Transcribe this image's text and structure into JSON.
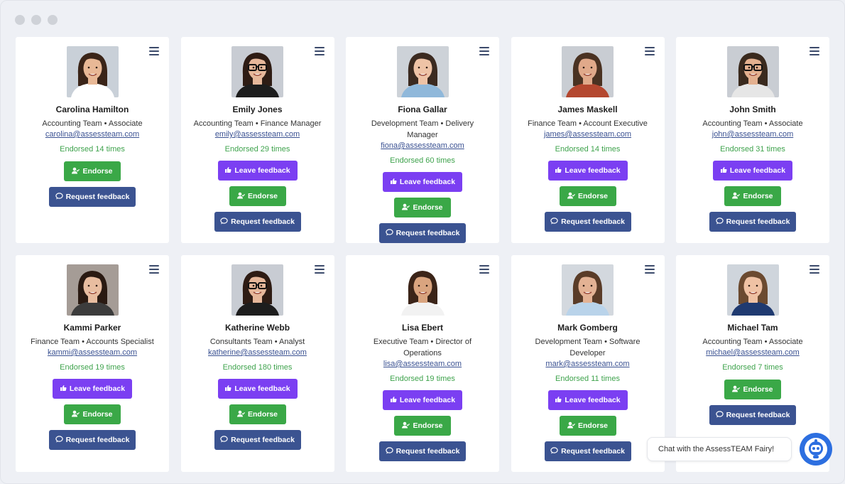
{
  "window": {
    "title": ""
  },
  "people": [
    {
      "name": "Carolina Hamilton",
      "role": "Accounting Team • Associate",
      "email": "carolina@assessteam.com",
      "endorsed": "Endorsed 14 times",
      "buttons": [
        "endorse",
        "request"
      ],
      "skin": "#e8b896",
      "hair": "#3a2418",
      "shirt": "#ffffff",
      "bg": "#c9d0d8",
      "glasses": false
    },
    {
      "name": "Emily Jones",
      "role": "Accounting Team • Finance Manager",
      "email": "emily@assessteam.com",
      "endorsed": "Endorsed 29 times",
      "buttons": [
        "leave",
        "endorse",
        "request"
      ],
      "skin": "#e6b79a",
      "hair": "#2e1c14",
      "shirt": "#1d1d1d",
      "bg": "#c8ccd3",
      "glasses": true
    },
    {
      "name": "Fiona Gallar",
      "role": "Development Team • Delivery Manager",
      "email": "fiona@assessteam.com",
      "endorsed": "Endorsed 60 times",
      "buttons": [
        "leave",
        "endorse",
        "request"
      ],
      "skin": "#eec3a6",
      "hair": "#3b2a20",
      "shirt": "#8fb8da",
      "bg": "#cdd2d8",
      "glasses": false
    },
    {
      "name": "James Maskell",
      "role": "Finance Team • Account Executive",
      "email": "james@assessteam.com",
      "endorsed": "Endorsed 14 times",
      "buttons": [
        "leave",
        "endorse",
        "request"
      ],
      "skin": "#e0a98a",
      "hair": "#4a3222",
      "shirt": "#b4472f",
      "bg": "#c9cdd3",
      "glasses": false
    },
    {
      "name": "John Smith",
      "role": "Accounting Team • Associate",
      "email": "john@assessteam.com",
      "endorsed": "Endorsed 31 times",
      "buttons": [
        "leave",
        "endorse",
        "request"
      ],
      "skin": "#e3b08f",
      "hair": "#3a2a1e",
      "shirt": "#e6e6e6",
      "bg": "#c9cdd3",
      "glasses": true
    },
    {
      "name": "Kammi Parker",
      "role": "Finance Team • Accounts Specialist",
      "email": "kammi@assessteam.com",
      "endorsed": "Endorsed 19 times",
      "buttons": [
        "leave",
        "endorse",
        "request"
      ],
      "skin": "#e8bda0",
      "hair": "#2a1a12",
      "shirt": "#3c3c3c",
      "bg": "#a59c96",
      "glasses": false
    },
    {
      "name": "Katherine Webb",
      "role": "Consultants Team • Analyst",
      "email": "katherine@assessteam.com",
      "endorsed": "Endorsed 180 times",
      "buttons": [
        "leave",
        "endorse",
        "request"
      ],
      "skin": "#e6b79a",
      "hair": "#2e1c14",
      "shirt": "#1d1d1d",
      "bg": "#c8ccd3",
      "glasses": true
    },
    {
      "name": "Lisa Ebert",
      "role": "Executive Team • Director of Operations",
      "email": "lisa@assessteam.com",
      "endorsed": "Endorsed 19 times",
      "buttons": [
        "leave",
        "endorse",
        "request"
      ],
      "skin": "#d9a47f",
      "hair": "#3b2418",
      "shirt": "#f2f2f2",
      "bg": "#ffffff",
      "glasses": false
    },
    {
      "name": "Mark Gomberg",
      "role": "Development Team • Software Developer",
      "email": "mark@assessteam.com",
      "endorsed": "Endorsed 11 times",
      "buttons": [
        "leave",
        "endorse",
        "request"
      ],
      "skin": "#e3b294",
      "hair": "#5a3c28",
      "shirt": "#b9d3ea",
      "bg": "#d3d8de",
      "glasses": false
    },
    {
      "name": "Michael Tam",
      "role": "Accounting Team • Associate",
      "email": "michael@assessteam.com",
      "endorsed": "Endorsed 7 times",
      "buttons": [
        "endorse",
        "request"
      ],
      "skin": "#efc2a4",
      "hair": "#6b4a30",
      "shirt": "#1f3a70",
      "bg": "#cfd5dc",
      "glasses": false
    }
  ],
  "labels": {
    "leave": "Leave feedback",
    "endorse": "Endorse",
    "request": "Request feedback"
  },
  "icons": {
    "leave": "thumbs-up-icon",
    "endorse": "user-check-icon",
    "request": "chat-bubble-icon",
    "menu": "hamburger-menu-icon"
  },
  "colors": {
    "leave": "#7b3ff2",
    "endorse": "#3aa847",
    "request": "#3b5391",
    "endorsed_text": "#3fa34d",
    "email": "#3a5192"
  },
  "chat": {
    "label": "Chat with the AssessTEAM Fairy!",
    "icon": "fairy-robot-icon"
  }
}
